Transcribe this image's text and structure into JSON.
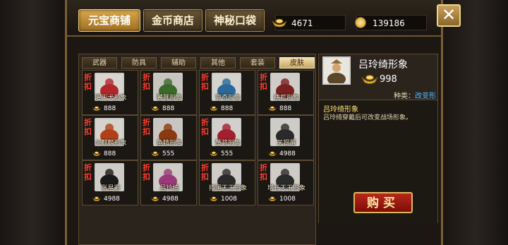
{
  "tabs": {
    "main": [
      "元宝商铺",
      "金币商店",
      "神秘口袋"
    ],
    "sub": [
      "武器",
      "防具",
      "辅助",
      "其他",
      "套装",
      "皮肤"
    ]
  },
  "currency": {
    "ingot": "4671",
    "gold": "139186"
  },
  "close_label": "✕",
  "items": [
    {
      "badge": "折扣",
      "name": "曜天犬形象",
      "price": "888"
    },
    {
      "badge": "折扣",
      "name": "饕餮形象",
      "price": "888"
    },
    {
      "badge": "折扣",
      "name": "穷奇形象",
      "price": "888"
    },
    {
      "badge": "折扣",
      "name": "梼杌形象",
      "price": "888"
    },
    {
      "badge": "折扣",
      "name": "火麒麟形象",
      "price": "888"
    },
    {
      "badge": "折扣",
      "name": "鱼精形象",
      "price": "555"
    },
    {
      "badge": "折扣",
      "name": "蟹将形象",
      "price": "555"
    },
    {
      "badge": "",
      "name": "关银屏",
      "price": "4988"
    },
    {
      "badge": "折扣",
      "name": "张星彩",
      "price": "4988"
    },
    {
      "badge": "折扣",
      "name": "吕玲绮",
      "price": "4988"
    },
    {
      "badge": "折扣",
      "name": "持国天王形象",
      "price": "1008"
    },
    {
      "badge": "折扣",
      "name": "增长天王形象",
      "price": "1008"
    }
  ],
  "detail": {
    "title": "吕玲绮形象",
    "price": "998",
    "type_label": "种类：",
    "type_value": "改变形象",
    "subtitle": "吕玲绮形象",
    "description": "吕玲绮穿戴后可改变战场形象。"
  },
  "buy_label": "购买",
  "colors": {
    "accent": "#c99320",
    "badge": "#ff3d2e",
    "buy": "#9e1a0f",
    "link": "#56b8ff"
  }
}
